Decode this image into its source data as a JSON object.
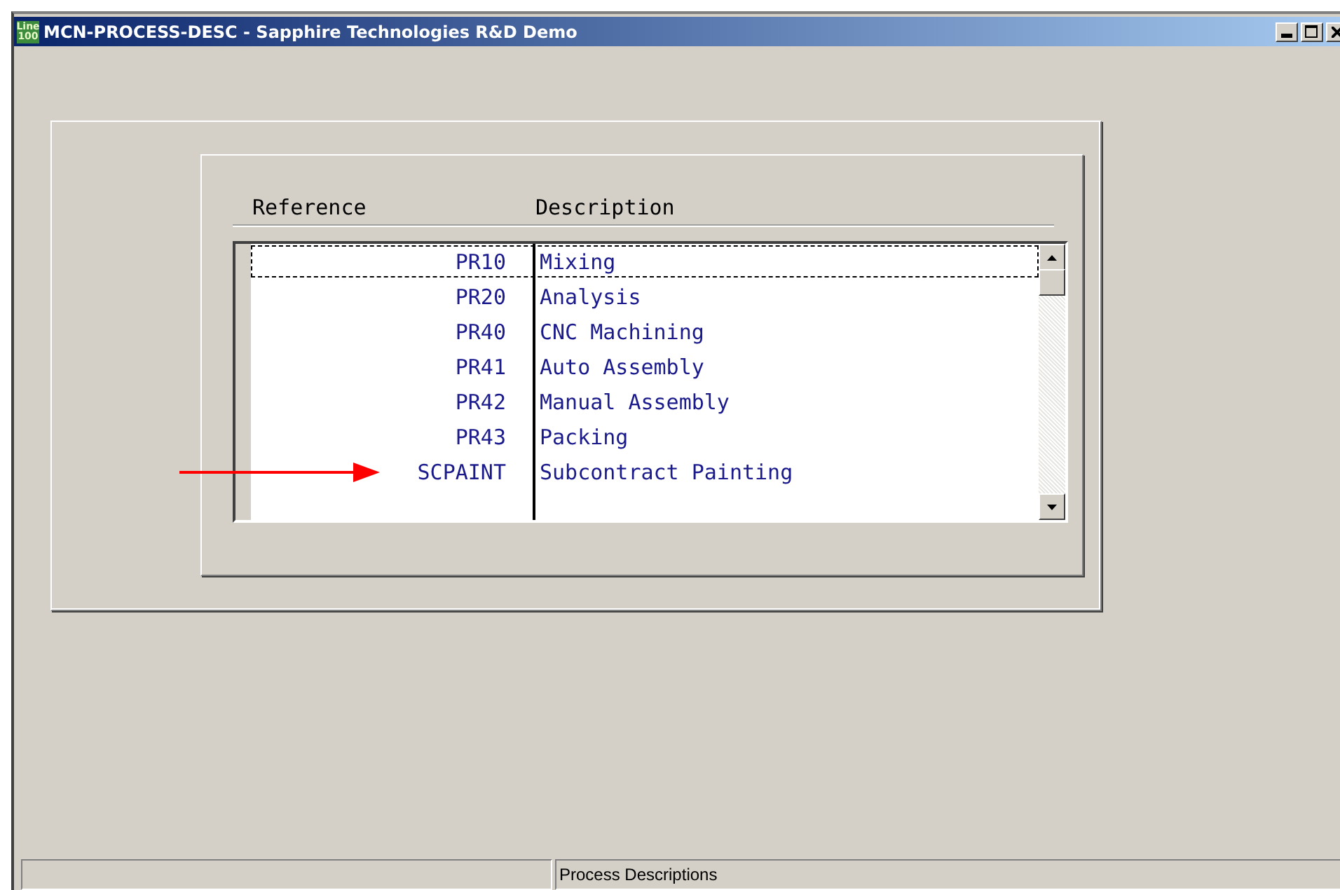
{
  "window": {
    "title": "MCN-PROCESS-DESC - Sapphire Technologies R&D Demo",
    "logo": [
      "Line",
      "100"
    ]
  },
  "table": {
    "columns": [
      "Reference",
      "Description"
    ],
    "rows": [
      {
        "reference": "PR10",
        "description": "Mixing",
        "focused": true
      },
      {
        "reference": "PR20",
        "description": "Analysis",
        "focused": false
      },
      {
        "reference": "PR40",
        "description": "CNC Machining",
        "focused": false
      },
      {
        "reference": "PR41",
        "description": "Auto Assembly",
        "focused": false
      },
      {
        "reference": "PR42",
        "description": "Manual Assembly",
        "focused": false
      },
      {
        "reference": "PR43",
        "description": "Packing",
        "focused": false
      },
      {
        "reference": "SCPAINT",
        "description": "Subcontract Painting",
        "focused": false,
        "pointed": true
      }
    ]
  },
  "status_bar": {
    "text": "Process Descriptions"
  }
}
